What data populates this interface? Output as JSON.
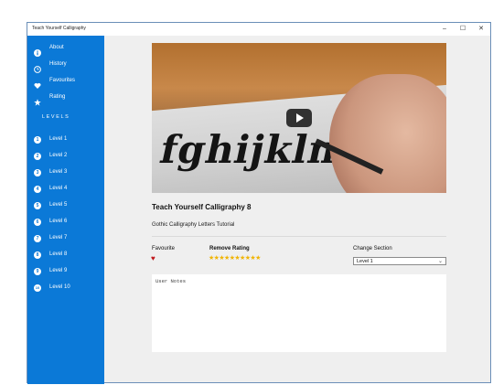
{
  "window": {
    "title": "Teach Yourself Calligraphy",
    "min": "–",
    "max": "☐",
    "close": "✕"
  },
  "sidebar": {
    "top_items": [
      {
        "label": "About",
        "icon": "info-icon"
      },
      {
        "label": "History",
        "icon": "clock-icon"
      },
      {
        "label": "Favourites",
        "icon": "heart-icon"
      },
      {
        "label": "Rating",
        "icon": "star-icon"
      }
    ],
    "levels_header": "LEVELS",
    "levels": [
      {
        "label": "Level 1",
        "num": "1"
      },
      {
        "label": "Level 2",
        "num": "2"
      },
      {
        "label": "Level 3",
        "num": "3"
      },
      {
        "label": "Level 4",
        "num": "4"
      },
      {
        "label": "Level 5",
        "num": "5"
      },
      {
        "label": "Level 6",
        "num": "6"
      },
      {
        "label": "Level 7",
        "num": "7"
      },
      {
        "label": "Level 8",
        "num": "8"
      },
      {
        "label": "Level 9",
        "num": "9"
      },
      {
        "label": "Level 10",
        "num": "10"
      }
    ]
  },
  "video": {
    "callig_text": "fghijkln"
  },
  "content": {
    "title": "Teach Yourself Calligraphy 8",
    "subtitle": "Gothic Calligraphy Letters Tutorial",
    "favourite_label": "Favourite",
    "favourite_icon": "♥",
    "remove_rating_label": "Remove Rating",
    "stars": "★★★★★★★★★★",
    "change_section_label": "Change Section",
    "section_value": "Level 1",
    "notes_placeholder": "User Notes"
  },
  "colors": {
    "sidebar": "#0b79d7",
    "heart": "#c0161b",
    "star": "#f0b400"
  }
}
